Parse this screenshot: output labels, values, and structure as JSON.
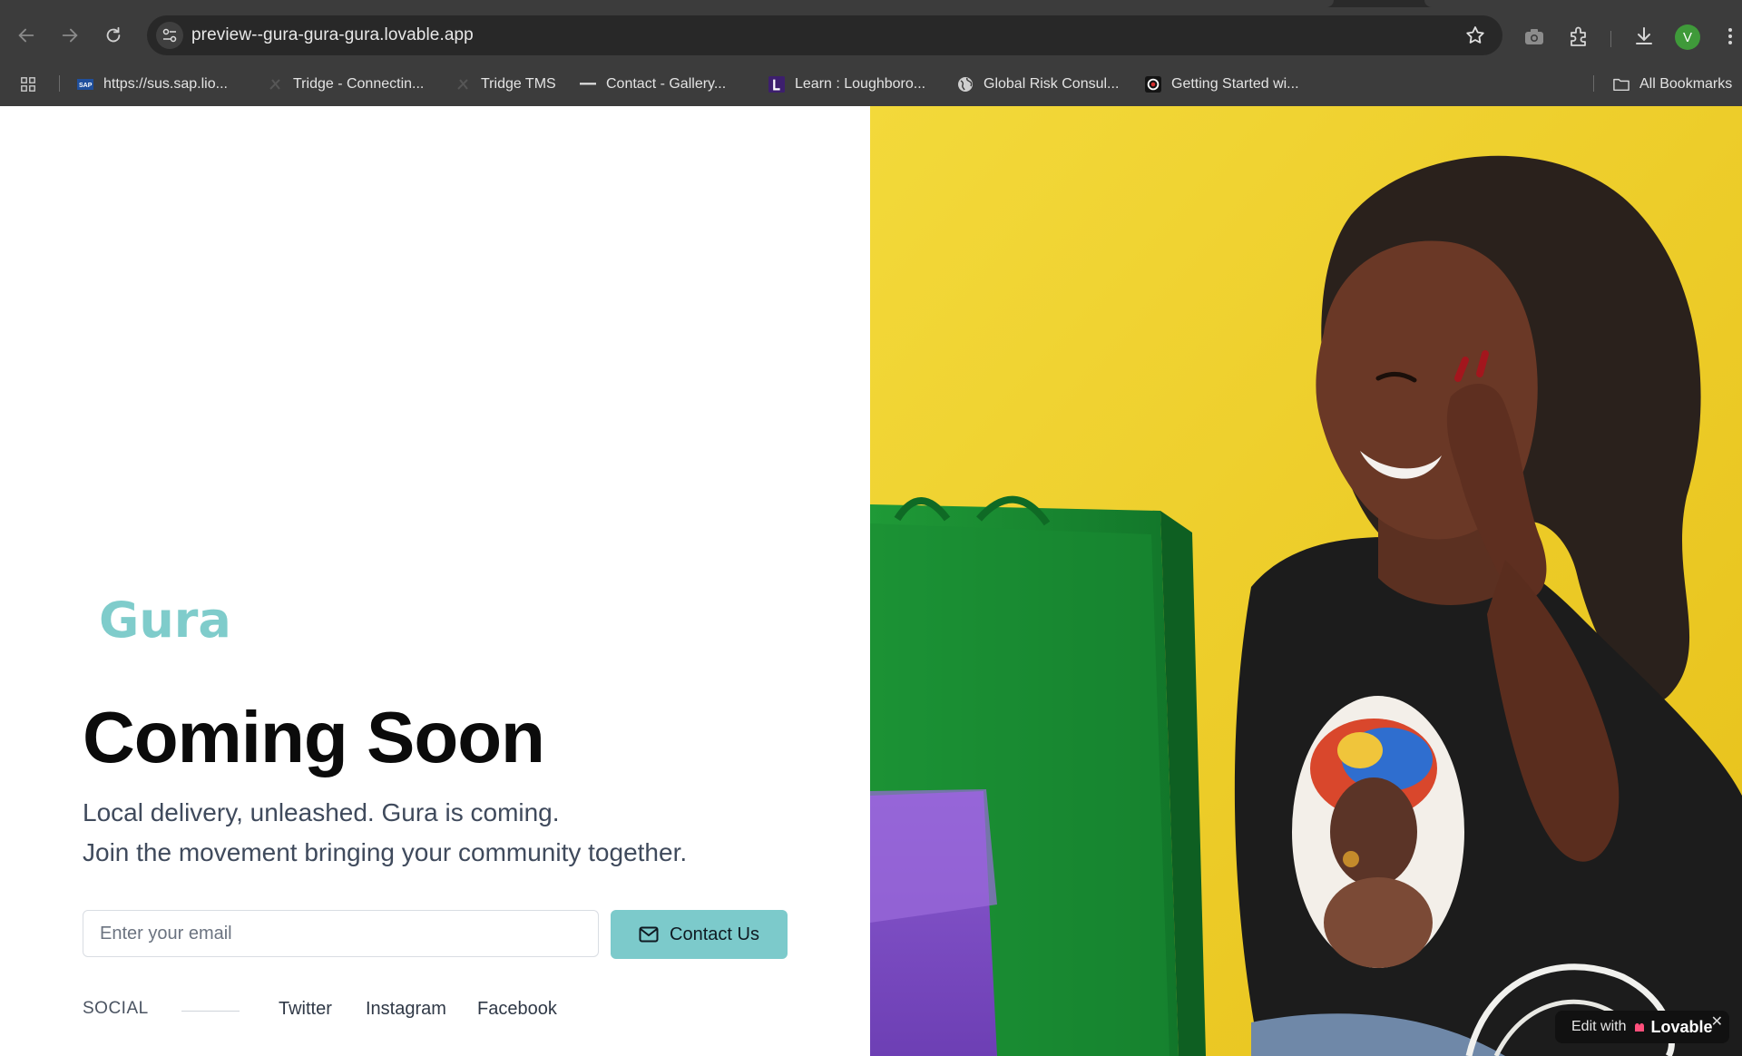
{
  "browser": {
    "url": "preview--gura-gura-gura.lovable.app",
    "profile_initial": "V",
    "bookmarks": [
      {
        "label": "https://sus.sap.lio...",
        "icon": "sap-icon"
      },
      {
        "label": "Tridge - Connectin...",
        "icon": "tridge-icon"
      },
      {
        "label": "Tridge TMS",
        "icon": "tridge-icon"
      },
      {
        "label": "Contact - Gallery...",
        "icon": "dash-icon"
      },
      {
        "label": "Learn : Loughboro...",
        "icon": "learn-l-icon"
      },
      {
        "label": "Global Risk Consul...",
        "icon": "globe-icon"
      },
      {
        "label": "Getting Started wi...",
        "icon": "target-icon"
      }
    ],
    "all_bookmarks": "All Bookmarks"
  },
  "page": {
    "logo": "Gura",
    "headline": "Coming Soon",
    "tagline_1": "Local delivery, unleashed. Gura is coming.",
    "tagline_2": "Join the movement bringing your community together.",
    "email_placeholder": "Enter your email",
    "contact_button": "Contact Us",
    "social_label": "SOCIAL",
    "social_links": [
      "Twitter",
      "Instagram",
      "Facebook"
    ],
    "brand_color": "#7ccacb"
  },
  "badge": {
    "prefix": "Edit with",
    "brand": "Lovable",
    "close": "✕"
  }
}
